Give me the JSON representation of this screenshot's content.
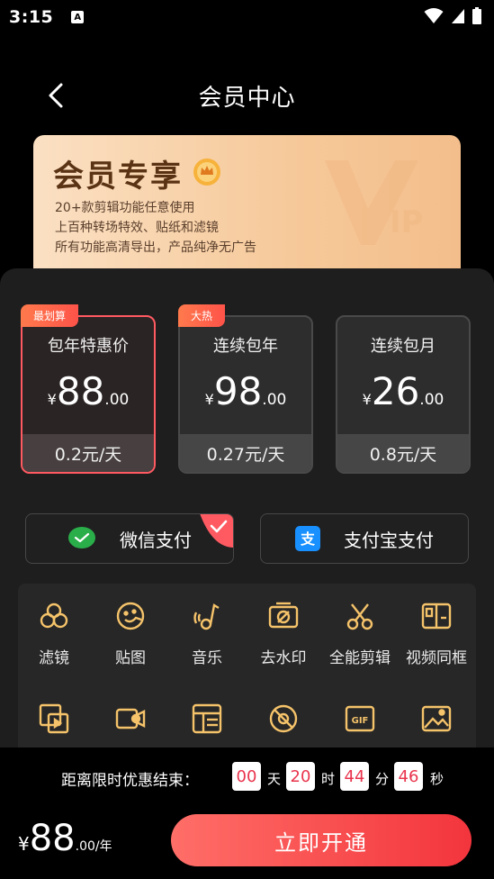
{
  "status": {
    "time": "3:15",
    "notification_letter": "A"
  },
  "nav": {
    "title": "会员中心"
  },
  "banner": {
    "title": "会员专享",
    "lines": [
      "20+款剪辑功能任意使用",
      "上百种转场特效、贴纸和滤镜",
      "所有功能高清导出，产品纯净无广告"
    ]
  },
  "plans": [
    {
      "tag": "最划算",
      "name": "包年特惠价",
      "currency": "¥",
      "price_int": "88",
      "price_dec": ".00",
      "per_day": "0.2元/天",
      "selected": true
    },
    {
      "tag": "大热",
      "name": "连续包年",
      "currency": "¥",
      "price_int": "98",
      "price_dec": ".00",
      "per_day": "0.27元/天",
      "selected": false
    },
    {
      "tag": "",
      "name": "连续包月",
      "currency": "¥",
      "price_int": "26",
      "price_dec": ".00",
      "per_day": "0.8元/天",
      "selected": false
    }
  ],
  "payment": [
    {
      "label": "微信支付",
      "icon": "wechat-icon",
      "selected": true
    },
    {
      "label": "支付宝支付",
      "icon": "alipay-icon",
      "selected": false
    }
  ],
  "features": [
    {
      "label": "滤镜",
      "icon": "filter-icon"
    },
    {
      "label": "贴图",
      "icon": "sticker-icon"
    },
    {
      "label": "音乐",
      "icon": "music-icon"
    },
    {
      "label": "去水印",
      "icon": "remove-watermark-icon"
    },
    {
      "label": "全能剪辑",
      "icon": "scissors-icon"
    },
    {
      "label": "视频同框",
      "icon": "split-screen-icon"
    }
  ],
  "features_row2_icons": [
    "picture-in-picture-icon",
    "video-camera-icon",
    "layout-template-icon",
    "no-ads-icon",
    "gif-icon",
    "image-icon"
  ],
  "countdown": {
    "label": "距离限时优惠结束：",
    "days": "00",
    "days_unit": "天",
    "hours": "20",
    "hours_unit": "时",
    "minutes": "44",
    "minutes_unit": "分",
    "seconds": "46",
    "seconds_unit": "秒"
  },
  "checkout": {
    "currency": "¥",
    "price_int": "88",
    "price_suffix": ".00/年",
    "button_label": "立即开通"
  },
  "colors": {
    "accent": "#ff5a62",
    "gold": "#f5c36a",
    "button_start": "#ff6e68",
    "button_end": "#f3353d",
    "panel": "#1e1e1e"
  }
}
